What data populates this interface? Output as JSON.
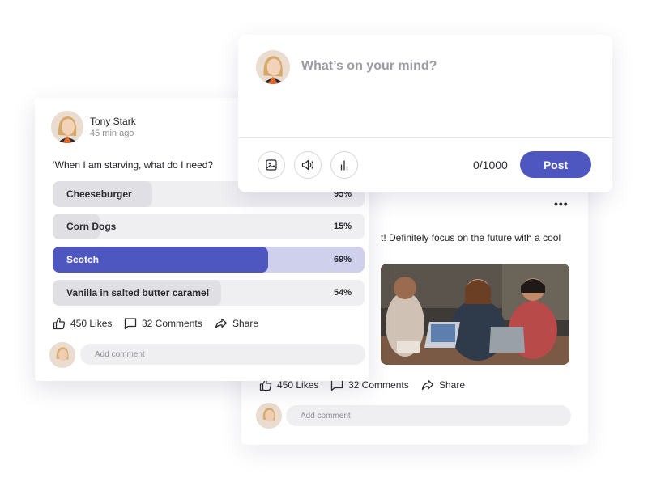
{
  "composer": {
    "prompt": "What’s on your mind?",
    "counter": "0/1000",
    "post_label": "Post",
    "tools": [
      "image-icon",
      "speaker-icon",
      "bar-chart-icon"
    ]
  },
  "poll_post": {
    "author": "Tony Stark",
    "time": "45 min ago",
    "question": "‘When I am starving, what do I need?",
    "options": [
      {
        "label": "Cheeseburger",
        "percent": "95%",
        "fraction": 0.32,
        "selected": false
      },
      {
        "label": "Corn Dogs",
        "percent": "15%",
        "fraction": 0.15,
        "selected": false
      },
      {
        "label": "Scotch",
        "percent": "69%",
        "fraction": 0.69,
        "selected": true
      },
      {
        "label": "Vanilla in salted butter caramel",
        "percent": "54%",
        "fraction": 0.54,
        "selected": false
      }
    ],
    "likes": "450 Likes",
    "comments": "32 Comments",
    "share": "Share",
    "comment_placeholder": "Add comment"
  },
  "photo_post": {
    "text": "t! Definitely focus on the future with a cool",
    "likes": "450 Likes",
    "comments": "32 Comments",
    "share": "Share",
    "comment_placeholder": "Add comment"
  },
  "colors": {
    "accent": "#4e56c0",
    "accent_light": "#cfd1ec",
    "track": "#efeff2"
  }
}
